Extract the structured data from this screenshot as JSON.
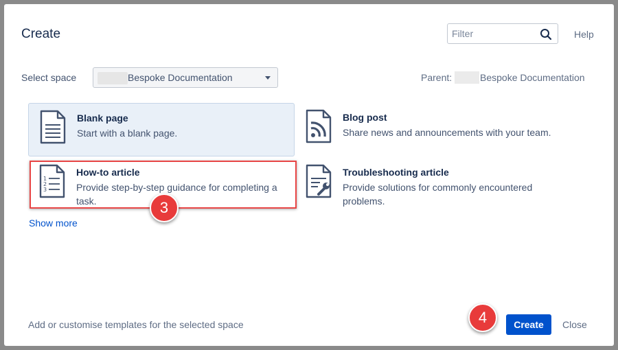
{
  "dialog": {
    "title": "Create",
    "help_label": "Help"
  },
  "filter": {
    "placeholder": "Filter",
    "value": ""
  },
  "space": {
    "label": "Select space",
    "selected": "Bespoke Documentation"
  },
  "parent": {
    "label": "Parent:",
    "value": "Bespoke Documentation"
  },
  "templates": [
    {
      "name": "Blank page",
      "description": "Start with a blank page.",
      "icon": "blank-page-icon",
      "selected": true
    },
    {
      "name": "Blog post",
      "description": "Share news and announcements with your team.",
      "icon": "blog-post-icon",
      "selected": false
    },
    {
      "name": "How-to article",
      "description": "Provide step-by-step guidance for completing a task.",
      "icon": "how-to-article-icon",
      "selected": false
    },
    {
      "name": "Troubleshooting article",
      "description": "Provide solutions for commonly encountered problems.",
      "icon": "troubleshooting-icon",
      "selected": false
    }
  ],
  "show_more_label": "Show more",
  "footer": {
    "customise_link": "Add or customise templates for the selected space",
    "create_label": "Create",
    "close_label": "Close"
  },
  "annotations": {
    "step_3": "3",
    "step_4": "4"
  },
  "colors": {
    "primary_button": "#0052cc",
    "selected_template_bg": "#e9f0f8",
    "annotation_red": "#e83b3b"
  }
}
